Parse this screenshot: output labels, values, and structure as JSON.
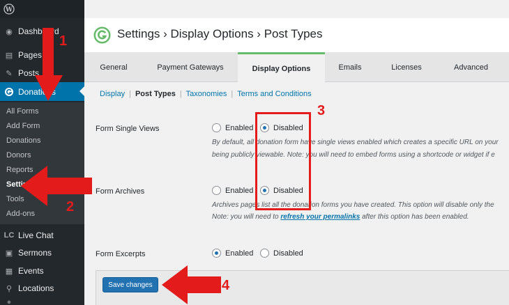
{
  "sidebar": {
    "menu": [
      {
        "label": "Dashboard",
        "icon": "dashboard-icon"
      },
      {
        "label": "Pages",
        "icon": "pages-icon"
      },
      {
        "label": "Posts",
        "icon": "posts-pin-icon"
      },
      {
        "label": "Donations",
        "icon": "givewp-icon"
      }
    ],
    "submenu": [
      "All Forms",
      "Add Form",
      "Donations",
      "Donors",
      "Reports",
      "Settings",
      "Tools",
      "Add-ons"
    ],
    "bottom_menu": [
      {
        "label": "Live Chat",
        "icon_text": "LC"
      },
      {
        "label": "Sermons",
        "icon": "sermons-icon"
      },
      {
        "label": "Events",
        "icon": "calendar-icon"
      },
      {
        "label": "Locations",
        "icon": "location-pin-icon"
      }
    ]
  },
  "header": {
    "title": "Settings › Display Options › Post Types"
  },
  "tabs": [
    "General",
    "Payment Gateways",
    "Display Options",
    "Emails",
    "Licenses",
    "Advanced"
  ],
  "subnav": {
    "items": [
      "Display",
      "Post Types",
      "Taxonomies",
      "Terms and Conditions"
    ],
    "separator": "|"
  },
  "form": {
    "single_views": {
      "label": "Form Single Views",
      "options": [
        "Enabled",
        "Disabled"
      ],
      "selected": "Disabled",
      "desc_line1": "By default, all donation form have single views enabled which creates a specific URL on your",
      "desc_line2": "being publicly viewable. Note: you will need to embed forms using a shortcode or widget if e"
    },
    "archives": {
      "label": "Form Archives",
      "options": [
        "Enabled",
        "Disabled"
      ],
      "selected": "Disabled",
      "desc_line1": "Archives pages list all the donation forms you have created. This option will disable only the",
      "desc_line2_pre": "Note: you will need to ",
      "desc_link": "refresh your permalinks",
      "desc_line2_post": " after this option has been enabled."
    },
    "excerpts": {
      "label": "Form Excerpts",
      "options": [
        "Enabled",
        "Disabled"
      ],
      "selected": "Enabled"
    },
    "save_label": "Save changes"
  },
  "annotations": [
    "1",
    "2",
    "3",
    "4"
  ],
  "colors": {
    "accent": "#0073aa",
    "annotation": "#e41b1b",
    "tab_highlight": "#66bb6a"
  }
}
